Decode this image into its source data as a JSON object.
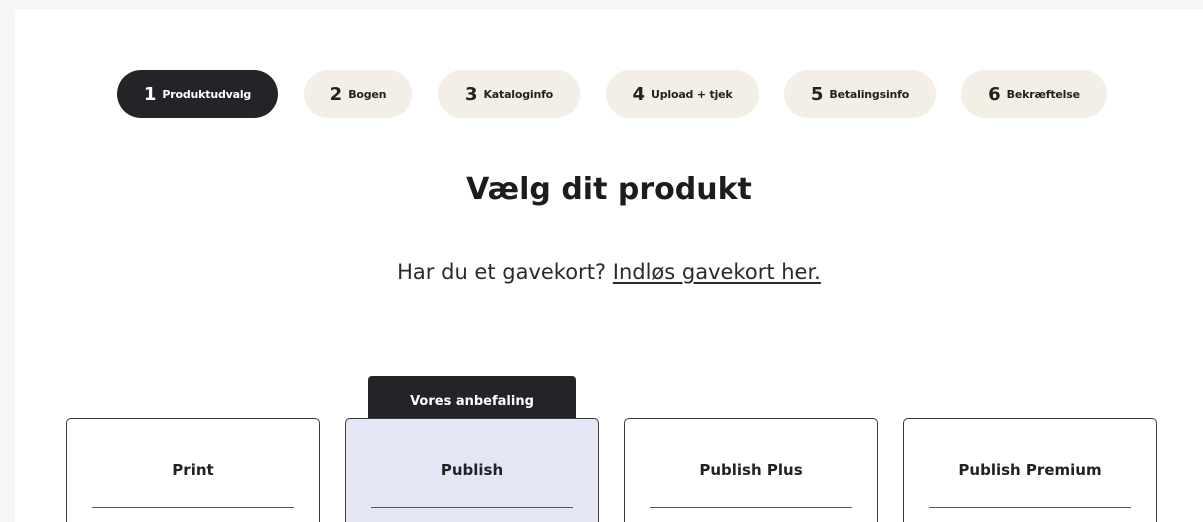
{
  "steps": [
    {
      "num": "1",
      "label": "Produktudvalg",
      "active": true
    },
    {
      "num": "2",
      "label": "Bogen",
      "active": false
    },
    {
      "num": "3",
      "label": "Kataloginfo",
      "active": false
    },
    {
      "num": "4",
      "label": "Upload + tjek",
      "active": false
    },
    {
      "num": "5",
      "label": "Betalingsinfo",
      "active": false
    },
    {
      "num": "6",
      "label": "Bekræftelse",
      "active": false
    }
  ],
  "heading": "Vælg dit produkt",
  "gift": {
    "text": "Har du et gavekort? ",
    "link": "Indløs gavekort her."
  },
  "recommendation_badge": "Vores anbefaling",
  "products": [
    {
      "name": "Print"
    },
    {
      "name": "Publish"
    },
    {
      "name": "Publish Plus"
    },
    {
      "name": "Publish Premium"
    }
  ],
  "colors": {
    "active_step": "#222428",
    "inactive_step": "#f4efe6",
    "featured_card": "#e4e6f5"
  }
}
